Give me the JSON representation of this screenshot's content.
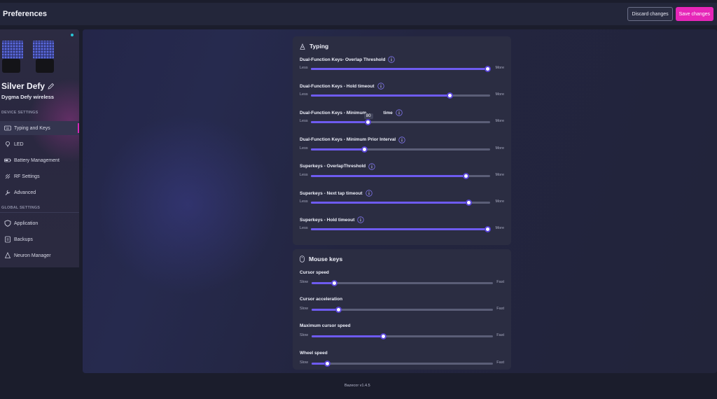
{
  "header": {
    "title": "Preferences",
    "discard_label": "Discard changes",
    "save_label": "Save changes",
    "save_color": "#e626b8"
  },
  "sidebar": {
    "device_name": "Silver Defy",
    "device_model": "Dygma Defy wireless",
    "device_settings_label": "DEVICE SETTINGS",
    "global_settings_label": "GLOBAL SETTINGS",
    "device_items": [
      {
        "label": "Typing and Keys",
        "icon": "keyboard-icon",
        "active": true
      },
      {
        "label": "LED",
        "icon": "bulb-icon"
      },
      {
        "label": "Battery Management",
        "icon": "battery-icon"
      },
      {
        "label": "RF Settings",
        "icon": "rf-icon"
      },
      {
        "label": "Advanced",
        "icon": "wrench-icon"
      }
    ],
    "global_items": [
      {
        "label": "Application",
        "icon": "shield-icon"
      },
      {
        "label": "Backups",
        "icon": "backup-icon"
      },
      {
        "label": "Neuron Manager",
        "icon": "neuron-icon"
      }
    ]
  },
  "typing": {
    "title": "Typing",
    "min_label": "Less",
    "max_label": "More",
    "settings": [
      {
        "label": "Dual-Function Keys- Overlap Threshold",
        "value": 0.985
      },
      {
        "label": "Dual-Function Keys - Hold timeout",
        "value": 0.775
      },
      {
        "label": "Dual-Function Keys - Minimum",
        "label_after": "time",
        "tooltip": "80",
        "value": 0.32
      },
      {
        "label": "Dual-Function Keys - Minimum Prior Interval",
        "value": 0.3
      },
      {
        "label": "Superkeys - OverlapThreshold",
        "value": 0.865
      },
      {
        "label": "Superkeys - Next tap timeout",
        "value": 0.88
      },
      {
        "label": "Superkeys - Hold timeout",
        "value": 0.985
      }
    ]
  },
  "mouse": {
    "title": "Mouse keys",
    "min_label": "Slow",
    "max_label": "Fast",
    "settings": [
      {
        "label": "Cursor speed",
        "value": 0.125
      },
      {
        "label": "Cursor acceleration",
        "value": 0.148
      },
      {
        "label": "Maximum cursor speed",
        "value": 0.395
      },
      {
        "label": "Wheel speed",
        "value": 0.085
      }
    ]
  },
  "footer": {
    "version": "Bazecor v1.4.5"
  },
  "colors": {
    "accent": "#6e5bf0",
    "active_marker": "#d428b8",
    "status_dot": "#29c7d6"
  }
}
